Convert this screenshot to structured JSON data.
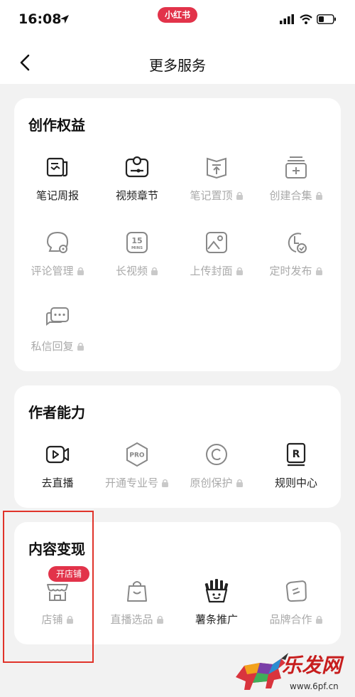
{
  "status_bar": {
    "time": "16:08",
    "app_pill": "小红书"
  },
  "nav": {
    "title": "更多服务"
  },
  "sections": [
    {
      "title": "创作权益",
      "items": [
        {
          "label": "笔记周报",
          "locked": false,
          "icon": "weekly-report-icon"
        },
        {
          "label": "视频章节",
          "locked": false,
          "icon": "video-chapter-icon"
        },
        {
          "label": "笔记置顶",
          "locked": true,
          "icon": "pin-top-icon"
        },
        {
          "label": "创建合集",
          "locked": true,
          "icon": "collection-icon"
        },
        {
          "label": "评论管理",
          "locked": true,
          "icon": "comment-manage-icon"
        },
        {
          "label": "长视频",
          "locked": true,
          "icon": "long-video-icon"
        },
        {
          "label": "上传封面",
          "locked": true,
          "icon": "upload-cover-icon"
        },
        {
          "label": "定时发布",
          "locked": true,
          "icon": "scheduled-publish-icon"
        },
        {
          "label": "私信回复",
          "locked": true,
          "icon": "message-reply-icon"
        }
      ]
    },
    {
      "title": "作者能力",
      "items": [
        {
          "label": "去直播",
          "locked": false,
          "icon": "live-stream-icon"
        },
        {
          "label": "开通专业号",
          "locked": true,
          "icon": "pro-account-icon"
        },
        {
          "label": "原创保护",
          "locked": true,
          "icon": "copyright-icon"
        },
        {
          "label": "规则中心",
          "locked": false,
          "icon": "rules-center-icon"
        }
      ]
    },
    {
      "title": "内容变现",
      "items": [
        {
          "label": "店铺",
          "locked": true,
          "icon": "shop-icon",
          "badge": "开店铺"
        },
        {
          "label": "直播选品",
          "locked": true,
          "icon": "live-selection-icon"
        },
        {
          "label": "薯条推广",
          "locked": false,
          "icon": "fries-promotion-icon"
        },
        {
          "label": "品牌合作",
          "locked": true,
          "icon": "brand-cooperation-icon"
        }
      ]
    }
  ],
  "watermark": {
    "text": "乐发网",
    "url": "www.6pf.cn"
  },
  "colors": {
    "brand": "#e2334a",
    "highlight": "#e0332a",
    "text": "#222222",
    "locked_text": "#aaaaaa",
    "background": "#f2f2f2"
  }
}
